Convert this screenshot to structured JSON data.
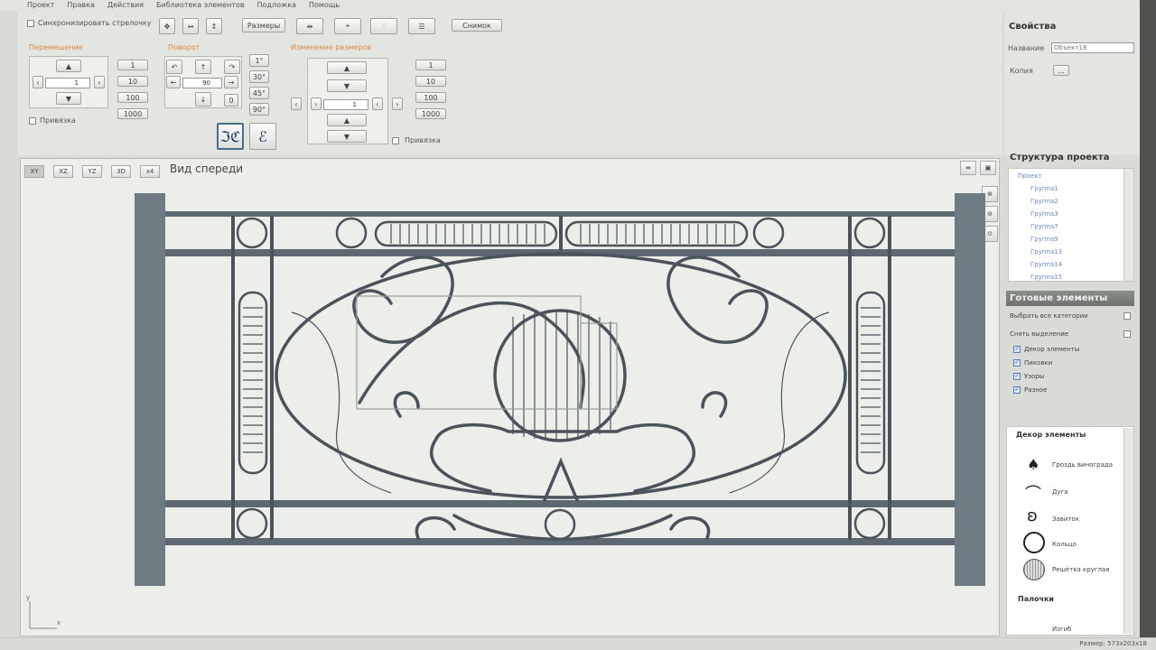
{
  "menu": [
    "Проект",
    "Правка",
    "Действия",
    "Библиотека элементов",
    "Подложка",
    "Помощь"
  ],
  "toolbar": {
    "sync_label": "Синхронизировать стрелочку",
    "sizes_label": "Размеры",
    "snapshot_label": "Снимок",
    "move_group": "Перемещение",
    "rotate_group": "Поворот",
    "resize_group": "Изменение размеров",
    "snap_label": "Привязка",
    "move_value": "1",
    "rotate_value": "90",
    "resize_value": "1",
    "step_buttons": [
      "1",
      "10",
      "100",
      "1000"
    ],
    "angle_buttons": [
      "1°",
      "30°",
      "45°",
      "90°"
    ],
    "rotate_zero": "0"
  },
  "properties": {
    "title": "Свойства",
    "name_label": "Название",
    "name_value": "Объект18",
    "copy_label": "Копия",
    "copy_button": "..."
  },
  "viewport": {
    "view_buttons": [
      "XY",
      "XZ",
      "YZ",
      "3D",
      "x4"
    ],
    "title": "Вид спереди",
    "axis_y": "y",
    "axis_x": "x"
  },
  "structure": {
    "title": "Структура проекта",
    "items": [
      "Проект",
      "Группа1",
      "Группа2",
      "Группа3",
      "Группа7",
      "Группа9",
      "Группа13",
      "Группа14",
      "Группа15"
    ]
  },
  "ready": {
    "title": "Готовые элементы",
    "select_all": "Выбрать все категории",
    "clear": "Снять выделение",
    "categories": [
      "Декор элементы",
      "Пиковки",
      "Узоры",
      "Разное"
    ]
  },
  "library": {
    "title": "Декор элементы",
    "items": [
      "Гроздь винограда",
      "Дуга",
      "Завиток",
      "Кольцо",
      "Решётка круглая"
    ],
    "section2": "Палочки",
    "section2_item": "Изгиб"
  },
  "status": {
    "size": "Размер: 573x203x18"
  }
}
